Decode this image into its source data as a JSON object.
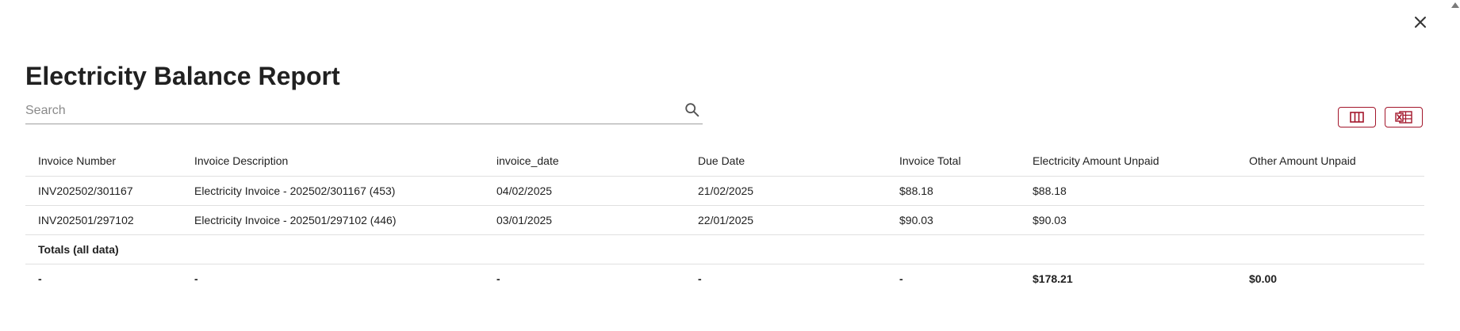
{
  "report": {
    "title": "Electricity Balance Report",
    "search_placeholder": "Search"
  },
  "table": {
    "columns": [
      "Invoice Number",
      "Invoice Description",
      "invoice_date",
      "Due Date",
      "Invoice Total",
      "Electricity Amount Unpaid",
      "Other Amount Unpaid"
    ],
    "rows": [
      [
        "INV202502/301167",
        "Electricity Invoice - 202502/301167 (453)",
        "04/02/2025",
        "21/02/2025",
        "$88.18",
        "$88.18",
        ""
      ],
      [
        "INV202501/297102",
        "Electricity Invoice - 202501/297102 (446)",
        "03/01/2025",
        "22/01/2025",
        "$90.03",
        "$90.03",
        ""
      ]
    ],
    "totals_label": "Totals (all data)",
    "totals": [
      "-",
      "-",
      "-",
      "-",
      "-",
      "$178.21",
      "$0.00"
    ]
  },
  "icons": {
    "close": "close-icon",
    "search": "search-icon",
    "columns": "columns-icon",
    "excel": "excel-export-icon"
  },
  "colors": {
    "accent": "#a3162b",
    "text": "#212121",
    "divider": "#e0e0e0"
  }
}
